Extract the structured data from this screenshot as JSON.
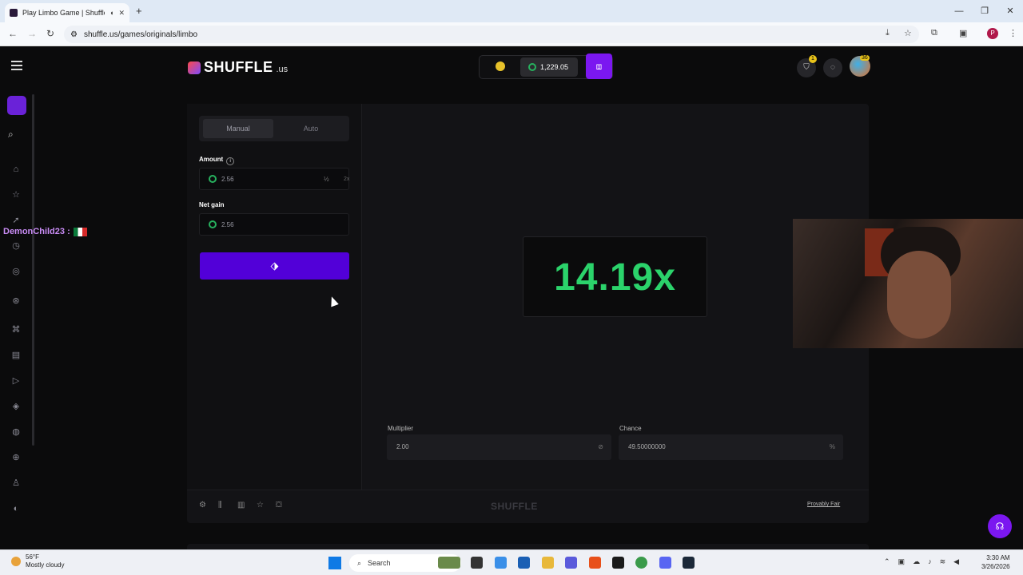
{
  "browser": {
    "tab_title": "Play Limbo Game | Shuffle.us",
    "url": "shuffle.us/games/originals/limbo",
    "profile_initial": "P"
  },
  "header": {
    "logo_text": "SHUFFLE",
    "logo_tld": ".us",
    "balance": "1,229.05",
    "notifications_count": "1",
    "level_badge": "36"
  },
  "controls": {
    "tabs": [
      "Manual",
      "Auto"
    ],
    "active_tab": "Manual",
    "amount_label": "Amount",
    "amount_value": "2.56",
    "half_label": "½",
    "double_label": "2x",
    "net_gain_label": "Net gain",
    "net_gain_value": "2.56"
  },
  "game": {
    "result": "14.19x",
    "multiplier_label": "Multiplier",
    "multiplier_value": "2.00",
    "chance_label": "Chance",
    "chance_value": "49.50000000",
    "chance_suffix": "%",
    "footer_logo": "SHUFFLE",
    "provably_fair": "Provably Fair"
  },
  "overlay": {
    "username": "DemonChild23 :"
  },
  "taskbar": {
    "temperature": "56°F",
    "weather": "Mostly cloudy",
    "search_placeholder": "Search",
    "time": "3:30 AM",
    "date": "3/26/2026"
  },
  "colors": {
    "accent": "#7b17f0",
    "bet_button": "#5200d8",
    "result_green": "#2bd36b"
  }
}
